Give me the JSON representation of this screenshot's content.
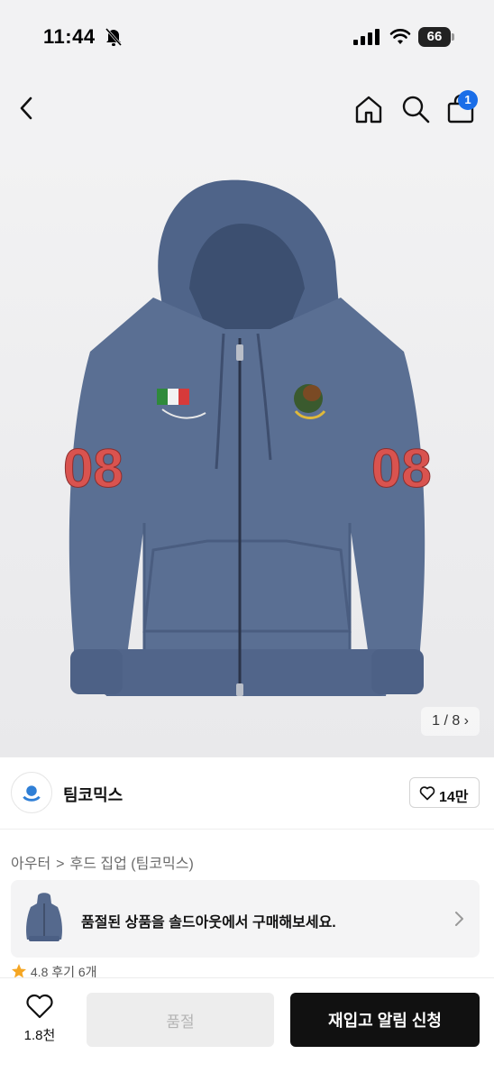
{
  "status_bar": {
    "time": "11:44",
    "battery": "66",
    "icons": [
      "bell-off-icon",
      "signal-icon",
      "wifi-icon",
      "battery-icon"
    ]
  },
  "nav": {
    "icons": [
      "back-icon",
      "home-icon",
      "search-icon",
      "shopping-bag-icon"
    ],
    "cart_badge": "1"
  },
  "gallery": {
    "counter": "1 / 8 ›",
    "patch_numbers": [
      "08",
      "08"
    ]
  },
  "brand": {
    "name": "팀코믹스",
    "like_count": "14만"
  },
  "breadcrumb": {
    "category": "아우터",
    "separator": ">",
    "subcategory": "후드 집업 (팀코믹스)"
  },
  "soldout_banner": {
    "text": "품절된 상품을 솔드아웃에서 구매해보세요."
  },
  "rating_peek": {
    "score": "4.8",
    "reviews": "후기 6개"
  },
  "bottom_bar": {
    "wish_count": "1.8천",
    "soldout_label": "품절",
    "notify_label": "재입고 알림 신청"
  },
  "colors": {
    "hoodie": "#5a6f93",
    "patch_red": "#d9534f",
    "badge_blue": "#1a6ee8",
    "primary_button": "#111111",
    "disabled_button": "#ededed"
  }
}
